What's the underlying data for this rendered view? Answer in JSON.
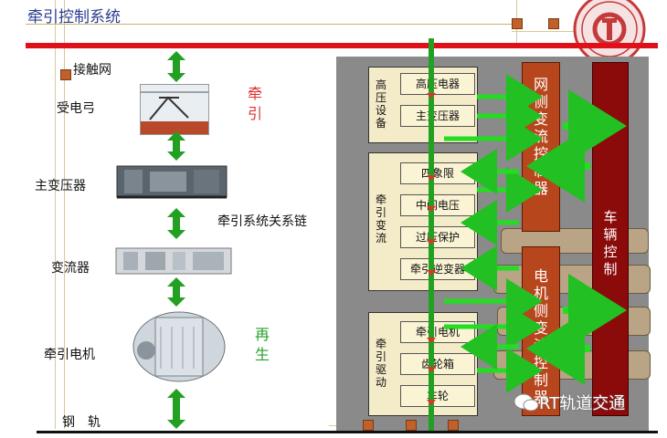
{
  "header": {
    "title": "牵引控制系统"
  },
  "left_chain": {
    "items": [
      {
        "label": "接触网"
      },
      {
        "label": "受电弓"
      },
      {
        "label": "主变压器"
      },
      {
        "label": "变流器"
      },
      {
        "label": "牵引电机"
      },
      {
        "label": "钢　轨"
      }
    ],
    "chain_label": "牵引系统关系链",
    "traction_label": "牵引",
    "regen_label": "再生"
  },
  "right_panel": {
    "groups": [
      {
        "label": "高压设备",
        "boxes": [
          "高压电器",
          "主变压器"
        ]
      },
      {
        "label": "牵引变流",
        "boxes": [
          "四象限",
          "中间电压",
          "过压保护",
          "牵引逆变器"
        ]
      },
      {
        "label": "牵引驱动",
        "boxes": [
          "牵引电机",
          "齿轮箱",
          "车轮"
        ]
      }
    ],
    "controllers": {
      "grid_side": "网侧变流控制器",
      "motor_side": "电机侧变流控制器",
      "vehicle": "车辆控制"
    }
  },
  "watermark": {
    "text": "RT轨道交通"
  },
  "colors": {
    "title": "#2a3d8f",
    "rail": "#e0101a",
    "arrow_green": "#22c022",
    "arrow_red": "#e03030",
    "controller": "#b8461c",
    "vehicle_controller": "#8b0a0a",
    "panel": "#8a8a8a"
  }
}
